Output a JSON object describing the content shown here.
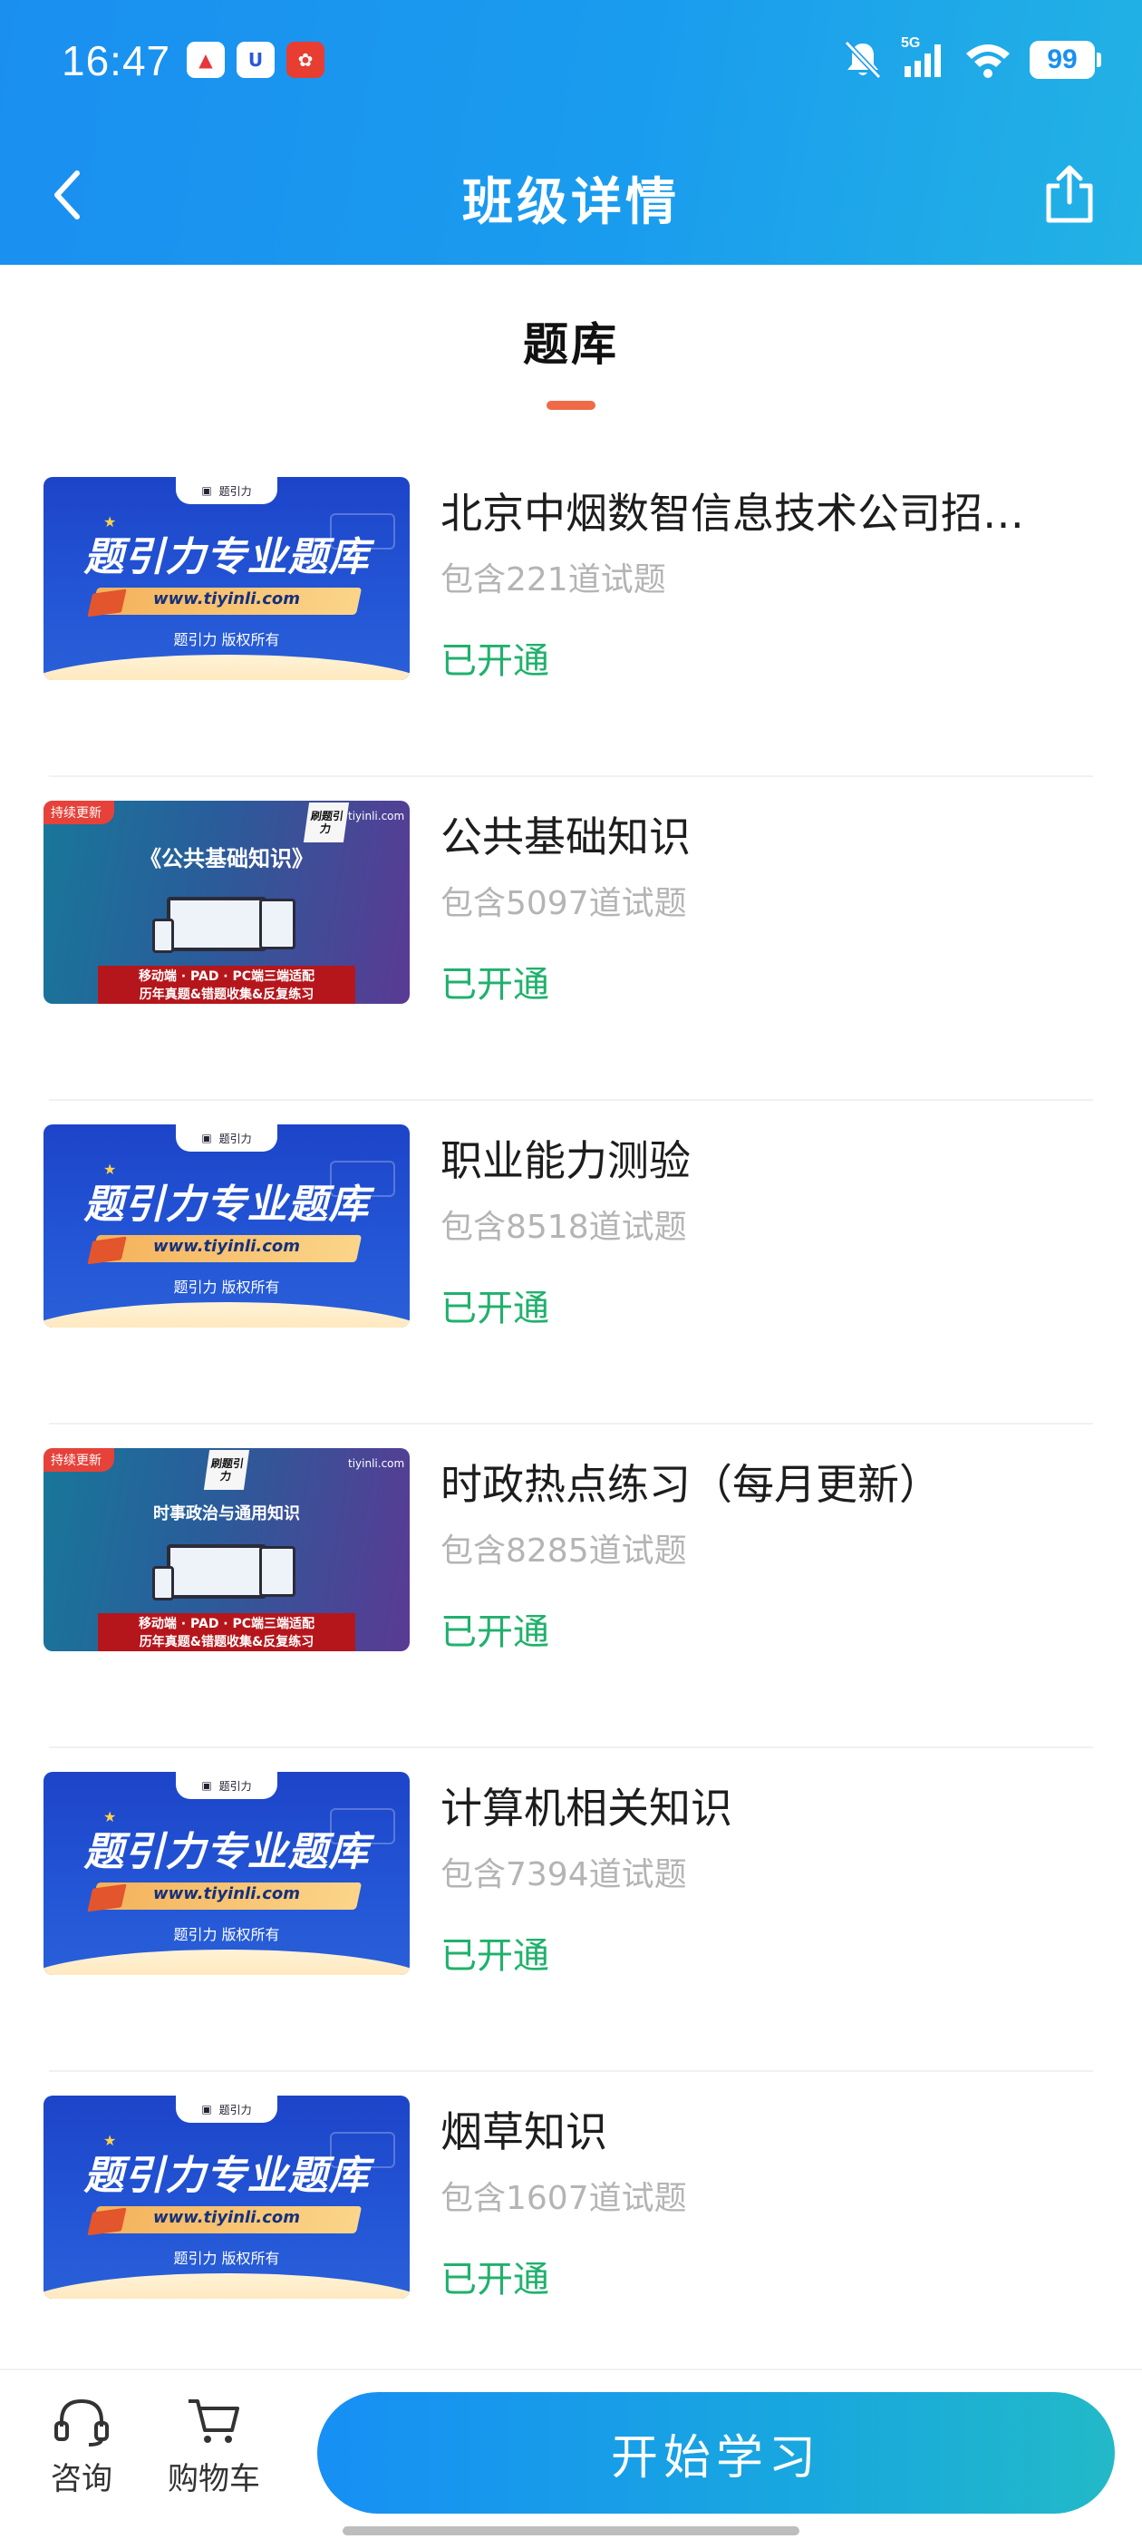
{
  "status_bar": {
    "time": "16:47",
    "network": "5G",
    "battery": "99",
    "icons": [
      "mute-bell-icon",
      "signal-icon",
      "wifi-icon",
      "battery-icon"
    ]
  },
  "nav": {
    "title": "班级详情",
    "back_icon": "chevron-left-icon",
    "share_icon": "share-icon"
  },
  "section_tab": {
    "label": "题库",
    "accent_color": "#ef6a47"
  },
  "thumbnails": {
    "blue": {
      "top_label": "题引力",
      "headline": "题引力专业题库",
      "url": "www.tiyinli.com",
      "copyright": "题引力 版权所有"
    },
    "purple": {
      "badge": "持续更新",
      "logo": "刷题引力",
      "site": "tiyinli.com",
      "footer_line1": "移动端 · PAD · PC端三端适配",
      "footer_line2": "历年真题&错题收集&反复练习"
    }
  },
  "banks": [
    {
      "title": "北京中烟数智信息技术公司招…",
      "count": "包含221道试题",
      "status": "已开通",
      "thumb": "blue"
    },
    {
      "title": "公共基础知识",
      "count": "包含5097道试题",
      "status": "已开通",
      "thumb": "purple",
      "thumb_headline": "《公共基础知识》"
    },
    {
      "title": "职业能力测验",
      "count": "包含8518道试题",
      "status": "已开通",
      "thumb": "blue"
    },
    {
      "title": "时政热点练习（每月更新）",
      "count": "包含8285道试题",
      "status": "已开通",
      "thumb": "purple",
      "thumb_headline": "时事政治与通用知识"
    },
    {
      "title": "计算机相关知识",
      "count": "包含7394道试题",
      "status": "已开通",
      "thumb": "blue"
    },
    {
      "title": "烟草知识",
      "count": "包含1607道试题",
      "status": "已开通",
      "thumb": "blue"
    }
  ],
  "bottom_bar": {
    "consult_label": "咨询",
    "cart_label": "购物车",
    "start_label": "开始学习"
  },
  "colors": {
    "header_gradient_start": "#1a8ff0",
    "header_gradient_end": "#22b2e4",
    "status_green": "#20b16c",
    "count_gray": "#b4b4b4"
  }
}
